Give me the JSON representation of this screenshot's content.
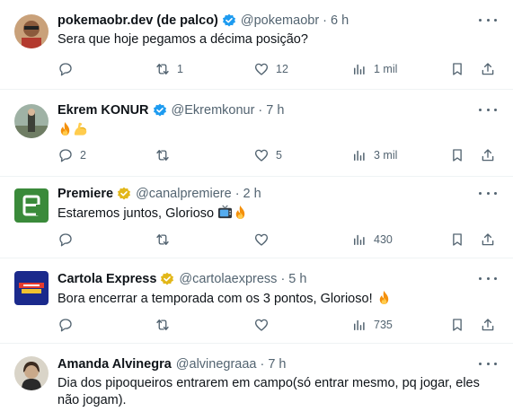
{
  "tweets": [
    {
      "name": "pokemaobr.dev (de palco)",
      "handle": "@pokemaobr",
      "time": "6 h",
      "text": "Sera que hoje pegamos a décima posição?",
      "badge": "blue",
      "replies": "",
      "retweets": "1",
      "likes": "12",
      "views": "1 mil"
    },
    {
      "name": "Ekrem KONUR",
      "handle": "@Ekremkonur",
      "time": "7 h",
      "text": "",
      "emojis": [
        "fire-emoji",
        "flexed-biceps-emoji"
      ],
      "badge": "blue",
      "replies": "2",
      "retweets": "",
      "likes": "5",
      "views": "3 mil"
    },
    {
      "name": "Premiere",
      "handle": "@canalpremiere",
      "time": "2 h",
      "text": "Estaremos juntos, Glorioso",
      "emojis": [
        "television-emoji",
        "fire-emoji"
      ],
      "badge": "gold",
      "replies": "",
      "retweets": "",
      "likes": "",
      "views": "430"
    },
    {
      "name": "Cartola Express",
      "handle": "@cartolaexpress",
      "time": "5 h",
      "text": "Bora encerrar a temporada com os 3 pontos, Glorioso!",
      "emojis": [
        "fire-emoji"
      ],
      "badge": "gold",
      "replies": "",
      "retweets": "",
      "likes": "",
      "views": "735"
    },
    {
      "name": "Amanda Alvinegra",
      "handle": "@alvinegraaa",
      "time": "7 h",
      "text": "Dia dos pipoqueiros entrarem em campo(só entrar mesmo, pq jogar, eles não jogam).",
      "badge": "",
      "replies": "",
      "retweets": "",
      "likes": "",
      "views": ""
    }
  ],
  "separator": "·",
  "colors": {
    "text": "#0f1419",
    "muted": "#536471",
    "verified_blue": "#1d9bf0",
    "verified_gold": "#e2b719",
    "border": "#eff3f4"
  },
  "icons": [
    "reply-icon",
    "retweet-icon",
    "like-icon",
    "views-icon",
    "bookmark-icon",
    "share-icon",
    "more-icon"
  ]
}
